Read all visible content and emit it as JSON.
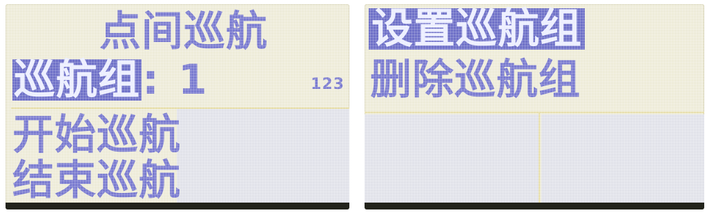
{
  "left_screen": {
    "title": "点间巡航",
    "group_label": "巡航组",
    "group_sep": ":",
    "group_value": "1",
    "group_hint": "123",
    "item_start": "开始巡航",
    "item_end": "结束巡航"
  },
  "right_screen": {
    "item_set_group": "设置巡航组",
    "item_delete_group": "删除巡航组"
  },
  "colors": {
    "lcd_text": "#7a7bd0",
    "highlight_bg": "#6f71c8",
    "screen_bg": "#eeecd9",
    "cell_bg": "#e2e3ea"
  }
}
